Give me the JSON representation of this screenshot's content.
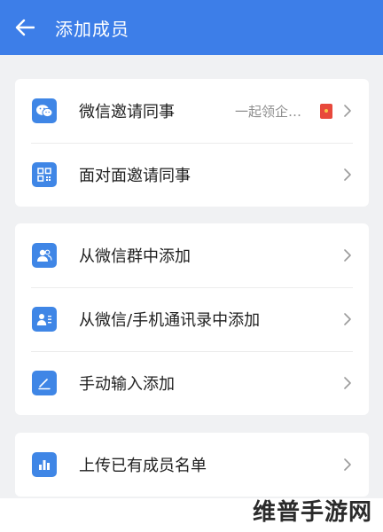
{
  "header": {
    "title": "添加成员",
    "bg_color": "#3d7ee8"
  },
  "groups": [
    {
      "items": [
        {
          "label": "微信邀请同事",
          "hint": "一起领企…",
          "icon": "wechat-icon",
          "badge": "red-envelope-icon"
        },
        {
          "label": "面对面邀请同事",
          "icon": "qrcode-icon"
        }
      ]
    },
    {
      "items": [
        {
          "label": "从微信群中添加",
          "icon": "group-contacts-icon"
        },
        {
          "label": "从微信/手机通讯录中添加",
          "icon": "contact-card-icon"
        },
        {
          "label": "手动输入添加",
          "icon": "pencil-icon"
        }
      ]
    },
    {
      "items": [
        {
          "label": "上传已有成员名单",
          "icon": "upload-list-icon"
        }
      ]
    }
  ],
  "watermark": "维普手游网",
  "accent_color": "#3f86e6"
}
